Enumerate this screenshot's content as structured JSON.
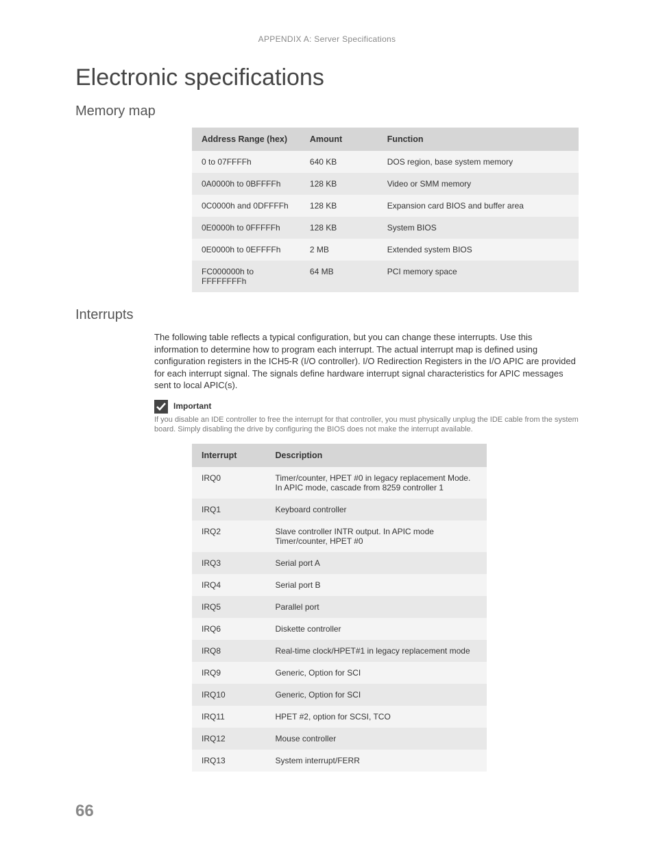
{
  "header": "APPENDIX A: Server Specifications",
  "title": "Electronic specifications",
  "section1": {
    "heading": "Memory map",
    "table": {
      "headers": [
        "Address Range (hex)",
        "Amount",
        "Function"
      ],
      "rows": [
        [
          "0 to 07FFFFh",
          "640 KB",
          "DOS region, base system memory"
        ],
        [
          "0A0000h to 0BFFFFh",
          "128 KB",
          "Video or SMM memory"
        ],
        [
          "0C0000h and 0DFFFFh",
          "128 KB",
          "Expansion card BIOS and buffer area"
        ],
        [
          "0E0000h to 0FFFFFh",
          "128 KB",
          "System BIOS"
        ],
        [
          "0E0000h to 0EFFFFh",
          "2 MB",
          "Extended system BIOS"
        ],
        [
          "FC000000h to FFFFFFFFh",
          "64 MB",
          "PCI memory space"
        ]
      ]
    }
  },
  "section2": {
    "heading": "Interrupts",
    "paragraph": "The following table reflects a typical configuration, but you can change these interrupts. Use this information to determine how to program each interrupt. The actual interrupt map is defined using configuration registers in the ICH5-R (I/O controller). I/O Redirection Registers in the I/O APIC are provided for each interrupt signal. The signals define hardware interrupt signal characteristics for APIC messages sent to local APIC(s).",
    "note": {
      "title": "Important",
      "body": "If you disable an IDE controller to free the interrupt for that controller, you must physically unplug the IDE cable from the system board. Simply disabling the drive by configuring the BIOS does not make the interrupt available."
    },
    "table": {
      "headers": [
        "Interrupt",
        "Description"
      ],
      "rows": [
        [
          "IRQ0",
          "Timer/counter, HPET #0 in legacy replacement Mode. In APIC mode, cascade from 8259 controller 1"
        ],
        [
          "IRQ1",
          "Keyboard controller"
        ],
        [
          "IRQ2",
          "Slave controller INTR output. In APIC mode Timer/counter, HPET #0"
        ],
        [
          "IRQ3",
          "Serial port A"
        ],
        [
          "IRQ4",
          "Serial port B"
        ],
        [
          "IRQ5",
          "Parallel port"
        ],
        [
          "IRQ6",
          "Diskette controller"
        ],
        [
          "IRQ8",
          "Real-time clock/HPET#1 in legacy replacement mode"
        ],
        [
          "IRQ9",
          "Generic, Option for SCI"
        ],
        [
          "IRQ10",
          "Generic, Option for SCI"
        ],
        [
          "IRQ11",
          "HPET #2, option for SCSI, TCO"
        ],
        [
          "IRQ12",
          "Mouse controller"
        ],
        [
          "IRQ13",
          "System interrupt/FERR"
        ]
      ]
    }
  },
  "page_number": "66"
}
